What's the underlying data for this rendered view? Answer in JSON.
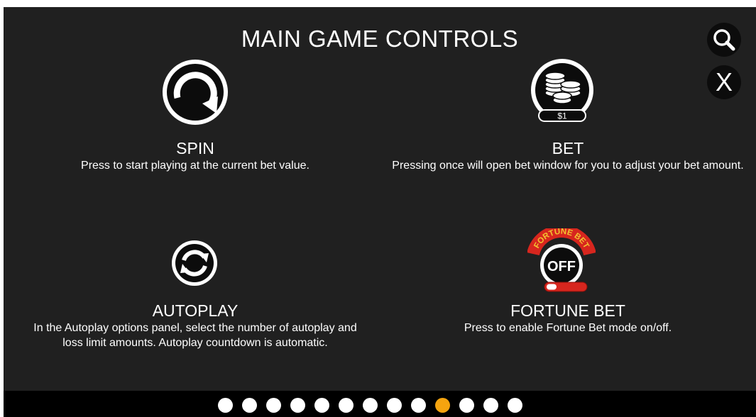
{
  "title": "MAIN GAME CONTROLS",
  "close_label": "X",
  "controls": {
    "spin": {
      "name": "SPIN",
      "description": "Press to start playing at the current bet value."
    },
    "bet": {
      "name": "BET",
      "description": "Pressing once will open bet window for you to adjust your bet amount.",
      "icon_amount": "$1"
    },
    "autoplay": {
      "name": "AUTOPLAY",
      "description": "In the Autoplay options panel, select the number of autoplay and loss limit amounts. Autoplay countdown is automatic."
    },
    "fortune_bet": {
      "name": "FORTUNE BET",
      "description": "Press to enable Fortune Bet mode on/off.",
      "badge_text": "FORTUNE BET",
      "state_label": "OFF"
    }
  },
  "icons": {
    "spin": "spin-arrow-icon",
    "bet": "coin-stacks-icon",
    "autoplay": "autoplay-arrows-icon",
    "fortune_bet": "fortune-bet-toggle-icon",
    "zoom": "magnifier-icon",
    "close": "close-icon"
  },
  "pagination": {
    "total_pages": 13,
    "current_page": 10
  },
  "colors": {
    "background": "#202020",
    "active_dot": "#f5a40f",
    "fortune_red": "#d7261e",
    "fortune_gold": "#f2c230"
  }
}
